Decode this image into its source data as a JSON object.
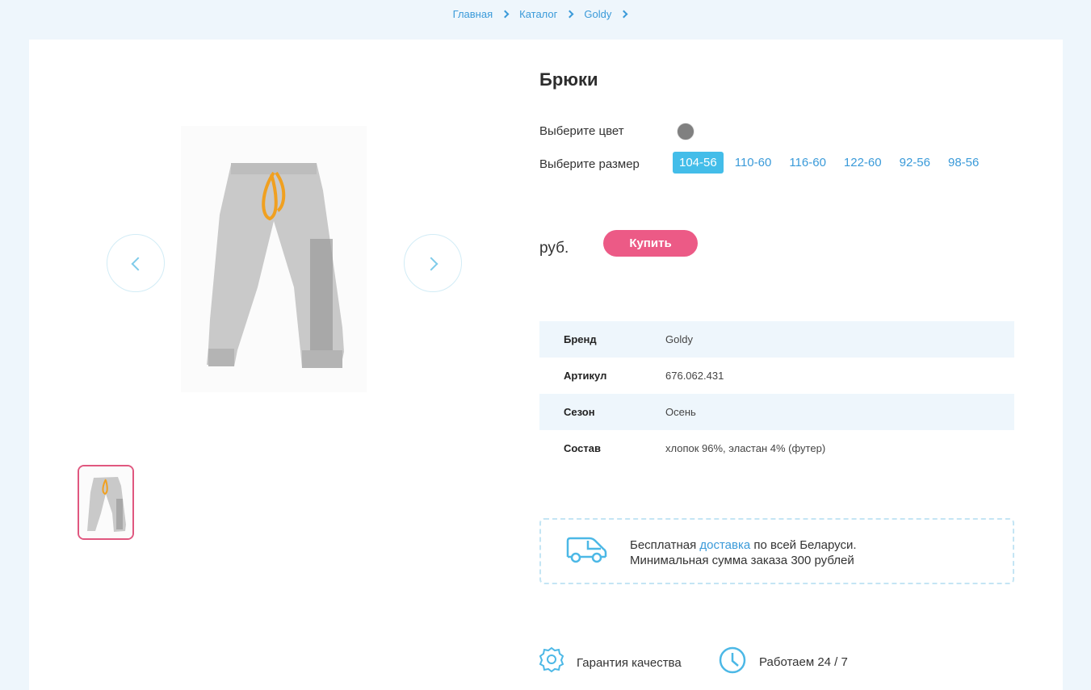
{
  "breadcrumbs": [
    "Главная",
    "Каталог",
    "Goldy"
  ],
  "product": {
    "title": "Брюки",
    "color_label": "Выберите цвет",
    "size_label": "Выберите размер",
    "color_value": "#808080",
    "sizes": [
      "104-56",
      "110-60",
      "116-60",
      "122-60",
      "92-56",
      "98-56"
    ],
    "selected_size": "104-56",
    "price_unit": "руб.",
    "buy_label": "Купить"
  },
  "specs": [
    {
      "key": "Бренд",
      "value": "Goldy"
    },
    {
      "key": "Артикул",
      "value": "676.062.431"
    },
    {
      "key": "Сезон",
      "value": "Осень"
    },
    {
      "key": "Состав",
      "value": "хлопок 96%, эластан 4% (футер)"
    }
  ],
  "delivery": {
    "text_before": "Бесплатная ",
    "link": "доставка",
    "text_after": " по всей Беларуси.",
    "line2": "Минимальная сумма заказа 300 рублей"
  },
  "features": {
    "quality": "Гарантия качества",
    "hours": "Работаем 24 / 7"
  },
  "colors": {
    "accent": "#3a9ad9",
    "button": "#ec5a86",
    "active_size": "#43bde9",
    "page_bg": "#eef6fc"
  },
  "icons": [
    "chevron-left-icon",
    "chevron-right-icon",
    "car-icon",
    "badge-icon",
    "clock-icon"
  ]
}
